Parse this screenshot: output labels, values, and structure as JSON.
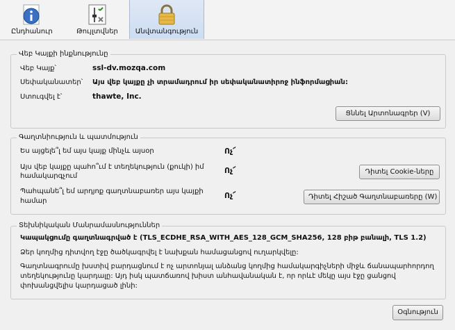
{
  "tabs": [
    {
      "label": "Ընդհանուր",
      "icon": "info-icon"
    },
    {
      "label": "Թույլտվներ",
      "icon": "permissions-icon"
    },
    {
      "label": "Անվտանգություն",
      "icon": "lock-icon"
    }
  ],
  "identity": {
    "title": "Վեբ Կայքի ինքնությունը",
    "website_key": "Վեբ Կայք՝",
    "website_val": "ssl-dv.mozqa.com",
    "owner_key": "Սեփականատեր՝",
    "owner_val": "Այս վեբ կայքը չի տրամադրում իր սեփականատիրոջ ինֆորմացիան:",
    "verified_key": "Ստուգվել է՝",
    "verified_val": "thawte, Inc.",
    "view_cert_label": "Ցննել Արտոնագրեր (V)"
  },
  "privacy": {
    "title": "Գաղտնիություն և պատմություն",
    "q1": "Ես այցելե՞լ եմ այս կայք մինչև այսօր",
    "a1": "Ոչ՜",
    "q2_line1": "Այս վեբ կայքը պահո՞ւմ է տեղեկություն (քուկի) իմ",
    "q2_line2": "համակարգչում",
    "a2": "Ոչ՜",
    "cookies_label": "Դիտել Cookie-ները",
    "q3_line1": "Պահպանե՞լ եմ արդյոք գաղտնաբառեր այս կայքի",
    "q3_line2": "համար",
    "a3": "Ոչ՜",
    "passwords_label": "Դիտել Հիշած Գաղտնաբառերը (W)"
  },
  "technical": {
    "title": "Տեխնիկական Մանրամասնություններ",
    "line1": "Կապակցումը գաղտնագրված է (TLS_ECDHE_RSA_WITH_AES_128_GCM_SHA256, 128 բիթ բանալի, TLS 1.2)",
    "line2": "Ձեր կողմից դիտվող էջը ծածկագրվել է նախքան համացանցով ուղարկվելը:",
    "line3": "Գաղտնագրումը խստիվ բարդացնում է ոչ արտոնյալ անձանց կողմից համակարգիչների միջև ճանապարհորդող",
    "line4": "տեղեկությունը կարդալը: Այդ իսկ պատճառով խիստ անհավանական է, որ որևէ մեկը այս էջը ցանցով",
    "line5": "փոխանցվելիս կարդացած լինի:"
  },
  "help_label": "Օգնություն"
}
